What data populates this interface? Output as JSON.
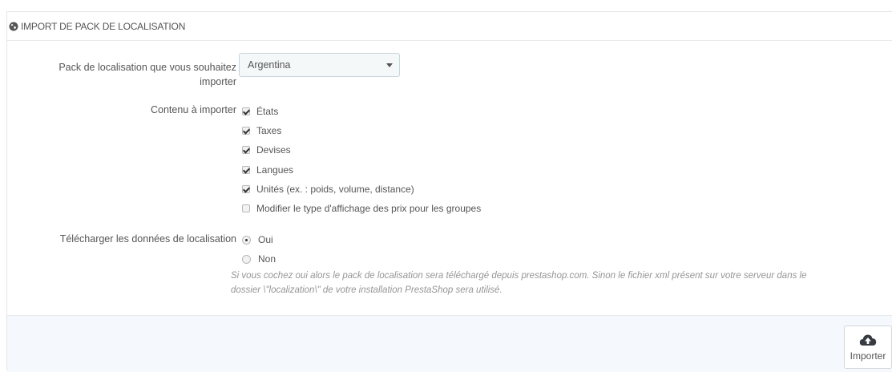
{
  "panel": {
    "title": "IMPORT DE PACK DE LOCALISATION",
    "title_icon": "globe-icon"
  },
  "pack": {
    "label_line1": "Pack de localisation que vous souhaitez",
    "label_line2": "importer",
    "selected": "Argentina"
  },
  "content": {
    "label": "Contenu à importer",
    "options": [
      {
        "label": "États",
        "checked": true
      },
      {
        "label": "Taxes",
        "checked": true
      },
      {
        "label": "Devises",
        "checked": true
      },
      {
        "label": "Langues",
        "checked": true
      },
      {
        "label": "Unités (ex. : poids, volume, distance)",
        "checked": true
      },
      {
        "label": "Modifier le type d'affichage des prix pour les groupes",
        "checked": false
      }
    ]
  },
  "download": {
    "label": "Télécharger les données de localisation",
    "options": [
      {
        "label": "Oui",
        "selected": true
      },
      {
        "label": "Non",
        "selected": false
      }
    ],
    "help_line1": "Si vous cochez oui alors le pack de localisation sera téléchargé depuis prestashop.com. Sinon le fichier xml présent sur votre serveur dans le",
    "help_line2": "dossier \\\"localization\\\" de votre installation PrestaShop sera utilisé."
  },
  "footer": {
    "import_label": "Importer",
    "import_icon": "cloud-upload-icon"
  }
}
